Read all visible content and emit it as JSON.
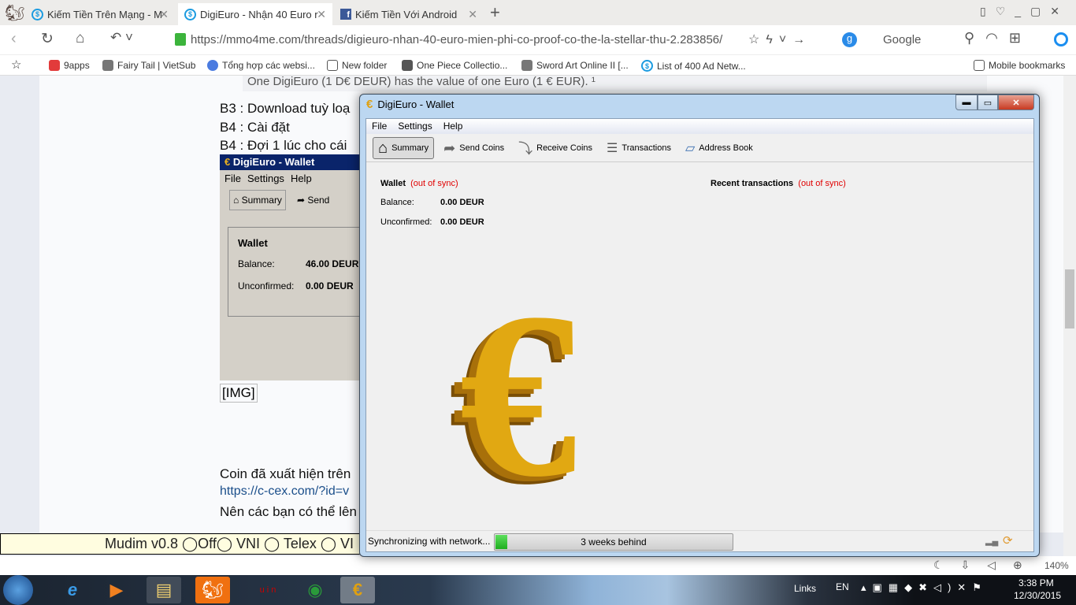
{
  "browser": {
    "tabs": [
      {
        "label": "Kiếm Tiền Trên Mạng - M"
      },
      {
        "label": "DigiEuro - Nhận 40 Euro r"
      },
      {
        "label": "Kiếm Tiền Với Android"
      }
    ],
    "url": "https://mmo4me.com/threads/digieuro-nhan-40-euro-mien-phi-co-proof-co-the-la-stellar-thu-2.283856/",
    "search_engine": "Google",
    "bookmarks": [
      "9apps",
      "Fairy Tail | VietSub",
      "Tổng hợp các websi...",
      "New folder",
      "One Piece Collectio...",
      "Sword Art Online II [...",
      "List of 400 Ad Netw..."
    ],
    "mobile_bookmarks": "Mobile bookmarks",
    "zoom": "140%"
  },
  "page": {
    "quote": "One DigiEuro (1 D€ DEUR) has the value of one Euro (1 € EUR). ¹",
    "lines": [
      "B3 : Download tuỳ loạ",
      "B4 : Cài đặt",
      "B4 : Đợi 1 lúc cho cái"
    ],
    "inner": {
      "title": "DigiEuro - Wallet",
      "menu": [
        "File",
        "Settings",
        "Help"
      ],
      "summary": "Summary",
      "send": "Send",
      "wallet": "Wallet",
      "balance_label": "Balance:",
      "balance": "46.00 DEUR",
      "unconfirmed_label": "Unconfirmed:",
      "unconfirmed": "0.00 DEUR"
    },
    "img_alt": "[IMG]",
    "after": [
      "Coin đã xuất hiện trên",
      "https://c-cex.com/?id=v",
      "Nên các bạn có thể lên"
    ]
  },
  "mudim": "Mudim v0.8 ◯Off◯ VNI ◯ Telex ◯ VI",
  "wallet": {
    "title": "DigiEuro - Wallet",
    "menu": [
      "File",
      "Settings",
      "Help"
    ],
    "toolbar": [
      "Summary",
      "Send Coins",
      "Receive Coins",
      "Transactions",
      "Address Book"
    ],
    "wallet_heading": "Wallet",
    "out_of_sync": "(out of sync)",
    "balance_label": "Balance:",
    "balance": "0.00 DEUR",
    "unconfirmed_label": "Unconfirmed:",
    "unconfirmed": "0.00 DEUR",
    "recent": "Recent transactions",
    "status": "Synchronizing with network...",
    "progress_text": "3 weeks behind",
    "progress_fraction": 0.05
  },
  "taskbar": {
    "links": "Links",
    "lang": "EN",
    "time": "3:38 PM",
    "date": "12/30/2015"
  }
}
